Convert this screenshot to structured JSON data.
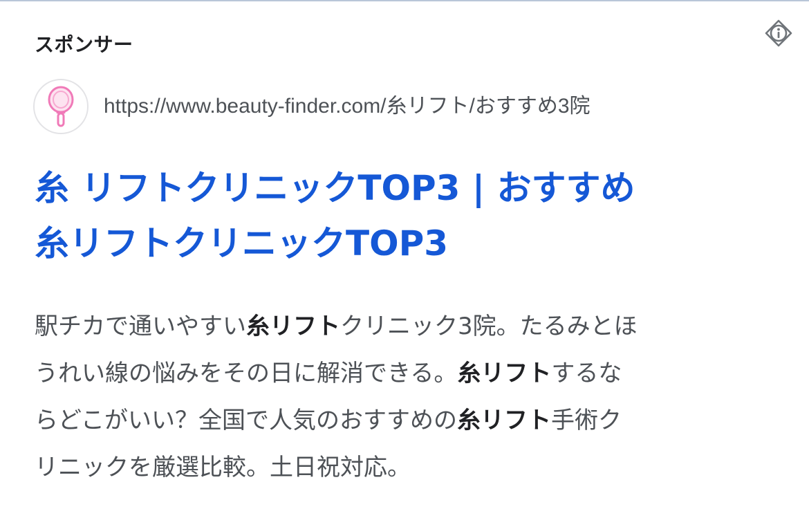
{
  "ad": {
    "sponsor_label": "スポンサー",
    "info_icon": "info-icon",
    "favicon_icon": "hand-mirror-icon",
    "display_url": "https://www.beauty-finder.com/糸リフト/おすすめ3院",
    "headline": {
      "line1": "糸 リフトクリニックTOP3 | おすすめ",
      "line2": "糸リフトクリニックTOP3"
    },
    "description": {
      "line1": [
        {
          "text": "駅チカで通いやすい",
          "bold": false
        },
        {
          "text": "糸リフト",
          "bold": true
        },
        {
          "text": "クリニック3院。たるみとほ",
          "bold": false
        }
      ],
      "line2": [
        {
          "text": "うれい線の悩みをその日に解消できる。",
          "bold": false
        },
        {
          "text": "糸リフト",
          "bold": true
        },
        {
          "text": "するな",
          "bold": false
        }
      ],
      "line3": [
        {
          "text": "らどこがいい？全国で人気のおすすめの",
          "bold": false
        },
        {
          "text": "糸リフト",
          "bold": true
        },
        {
          "text": "手術ク",
          "bold": false
        }
      ],
      "line4": [
        {
          "text": "リニックを厳選比較。土日祝対応。",
          "bold": false
        }
      ]
    }
  },
  "colors": {
    "headline_link": "#1558d6",
    "body_text": "#4d5156",
    "strong_text": "#202124",
    "favicon_pink": "#f07ab8",
    "favicon_ring": "#e3e3e6"
  }
}
